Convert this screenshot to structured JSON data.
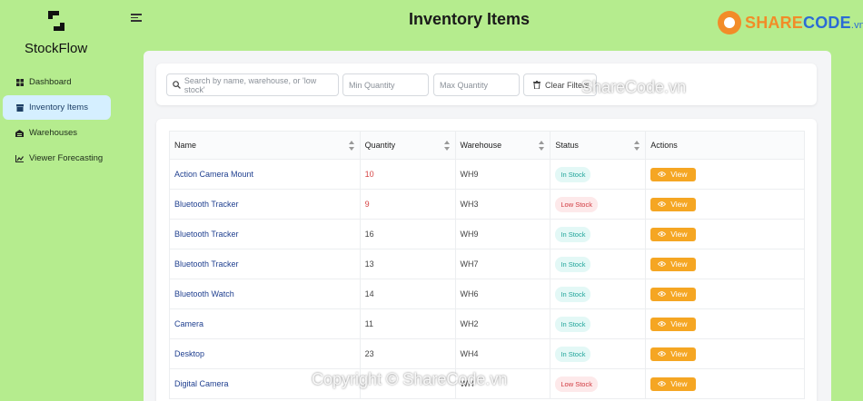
{
  "app": {
    "brand": "StockFlow",
    "page_title": "Inventory Items"
  },
  "sidebar": {
    "items": [
      {
        "label": "Dashboard",
        "icon": "dashboard-icon",
        "active": false
      },
      {
        "label": "Inventory Items",
        "icon": "inventory-icon",
        "active": true
      },
      {
        "label": "Warehouses",
        "icon": "warehouse-icon",
        "active": false
      },
      {
        "label": "Viewer Forecasting",
        "icon": "chart-icon",
        "active": false
      }
    ]
  },
  "filters": {
    "search_placeholder": "Search by name, warehouse, or 'low stock'",
    "min_placeholder": "Min Quantity",
    "max_placeholder": "Max Quantity",
    "clear_label": "Clear Filters"
  },
  "table": {
    "headers": [
      "Name",
      "Quantity",
      "Warehouse",
      "Status",
      "Actions"
    ],
    "view_label": "View",
    "rows": [
      {
        "name": "Action Camera Mount",
        "quantity": "10",
        "warehouse": "WH9",
        "status": "In Stock",
        "low": false,
        "qty_red": true
      },
      {
        "name": "Bluetooth Tracker",
        "quantity": "9",
        "warehouse": "WH3",
        "status": "Low Stock",
        "low": true,
        "qty_red": true
      },
      {
        "name": "Bluetooth Tracker",
        "quantity": "16",
        "warehouse": "WH9",
        "status": "In Stock",
        "low": false,
        "qty_red": false
      },
      {
        "name": "Bluetooth Tracker",
        "quantity": "13",
        "warehouse": "WH7",
        "status": "In Stock",
        "low": false,
        "qty_red": false
      },
      {
        "name": "Bluetooth Watch",
        "quantity": "14",
        "warehouse": "WH6",
        "status": "In Stock",
        "low": false,
        "qty_red": false
      },
      {
        "name": "Camera",
        "quantity": "11",
        "warehouse": "WH2",
        "status": "In Stock",
        "low": false,
        "qty_red": false
      },
      {
        "name": "Desktop",
        "quantity": "23",
        "warehouse": "WH4",
        "status": "In Stock",
        "low": false,
        "qty_red": false
      },
      {
        "name": "Digital Camera",
        "quantity": "",
        "warehouse": "WH",
        "status": "Low Stock",
        "low": true,
        "qty_red": false
      }
    ]
  },
  "watermarks": {
    "logo_text_a": "SHARE",
    "logo_text_b": "CODE",
    "logo_text_c": ".vn",
    "overlay": "ShareCode.vn",
    "copyright": "Copyright © ShareCode.vn"
  },
  "colors": {
    "sidebar_bg": "#b5ec8e",
    "accent_view": "#f5a623",
    "in_stock": "#20a49a",
    "low_stock": "#d0393f",
    "link": "#1f3f8f"
  }
}
